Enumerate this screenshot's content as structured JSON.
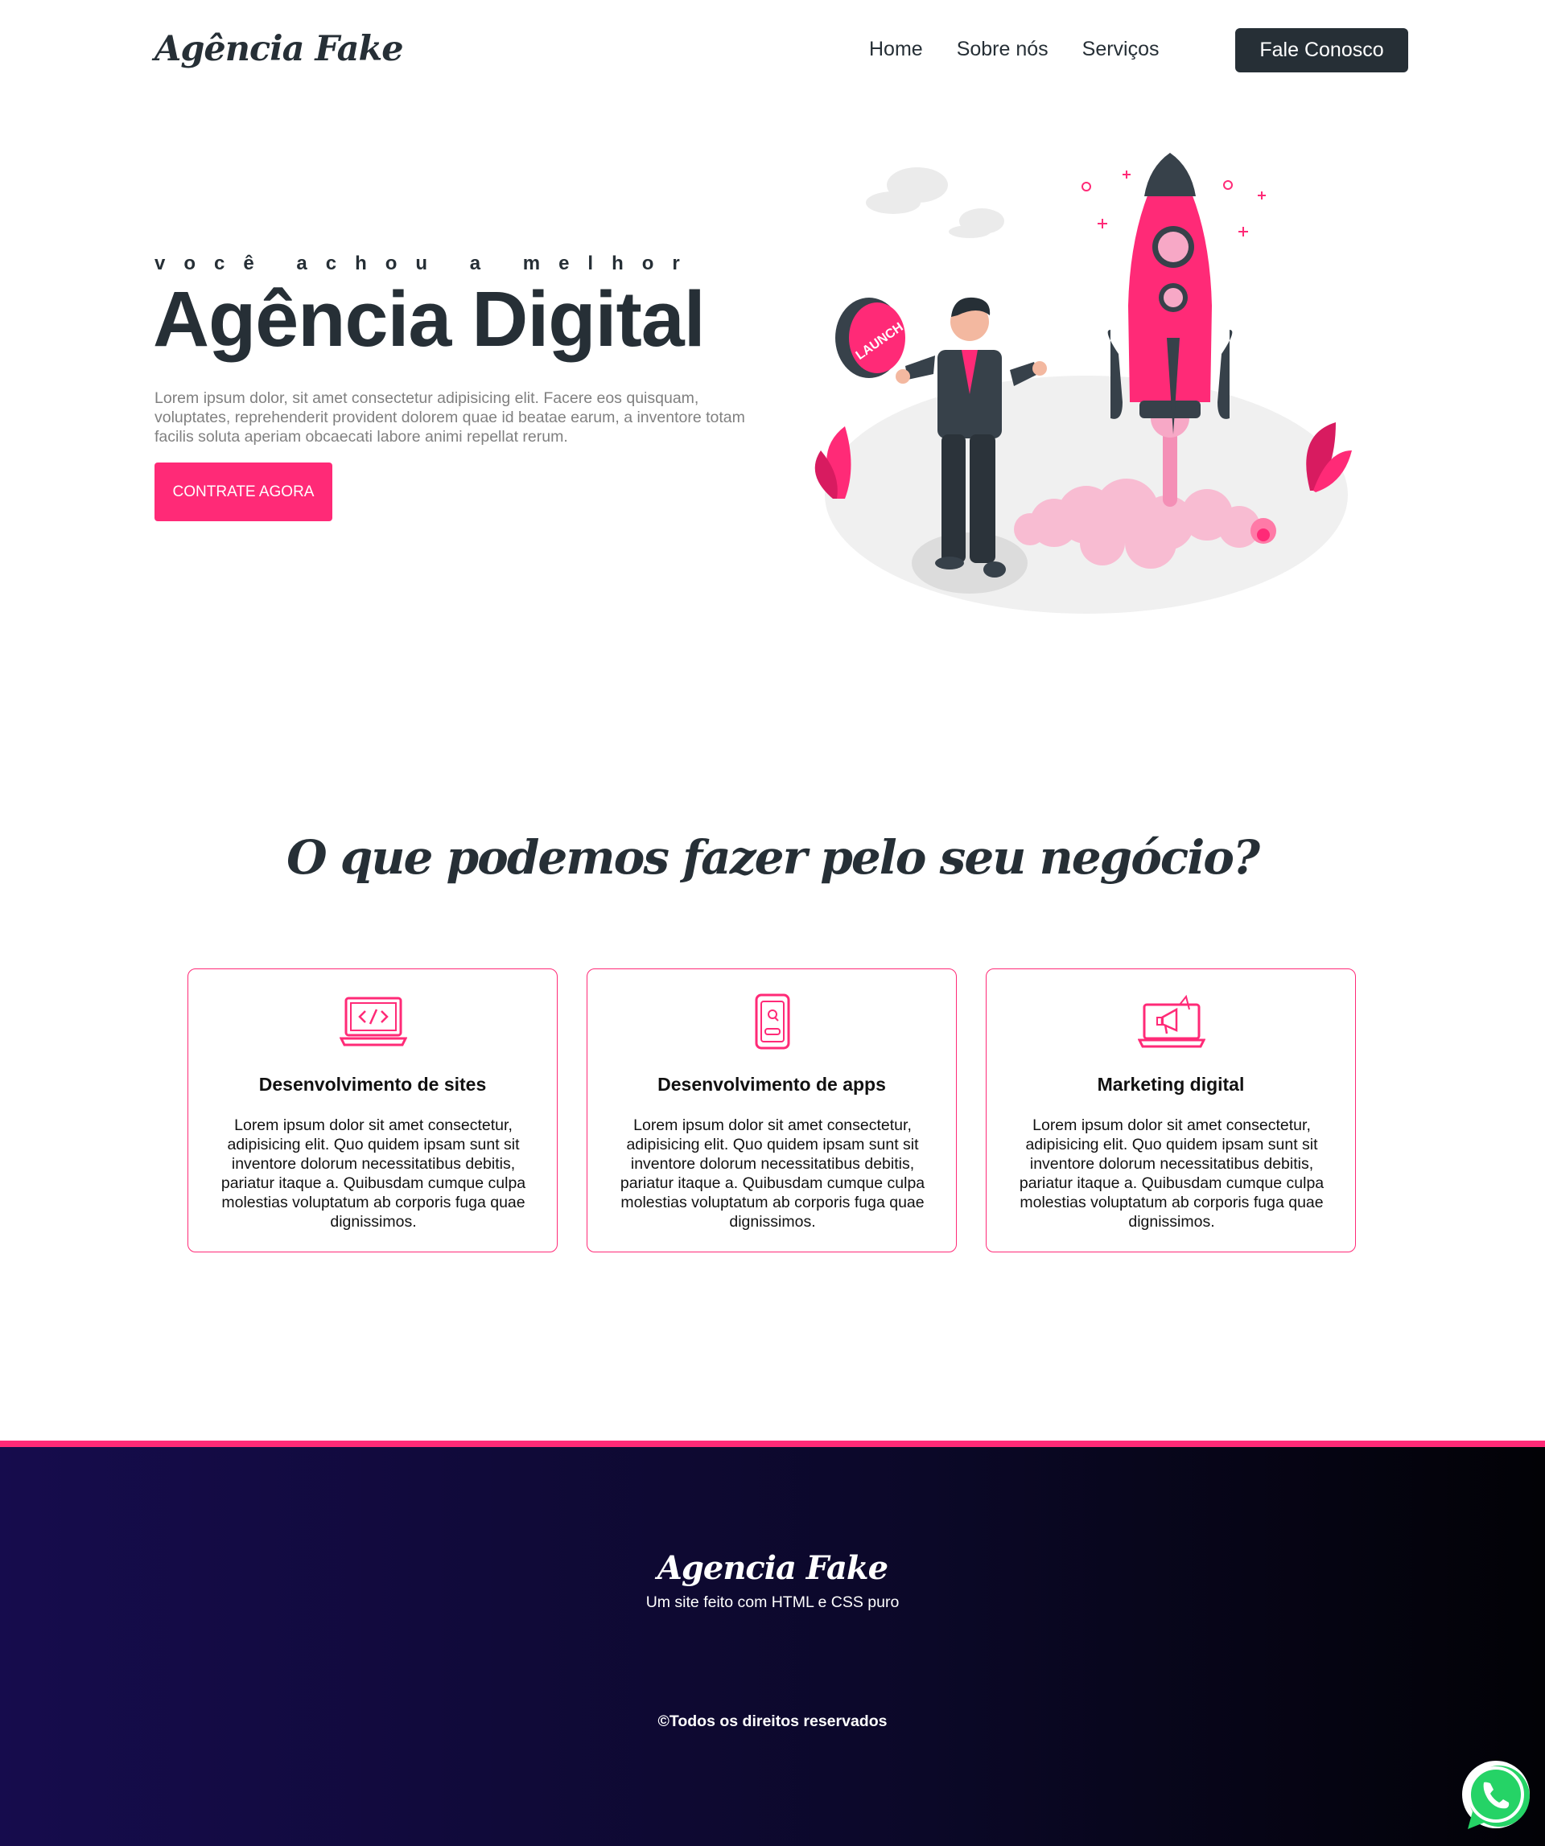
{
  "header": {
    "logo": "Agência Fake",
    "nav": [
      "Home",
      "Sobre nós",
      "Serviços"
    ],
    "cta": "Fale Conosco"
  },
  "hero": {
    "kicker": "você achou a melhor",
    "title": "Agência Digital",
    "text": "Lorem ipsum dolor, sit amet consectetur adipisicing elit. Facere eos quisquam, voluptates, reprehenderit provident dolorem quae id beatae earum, a inventore totam facilis soluta aperiam obcaecati labore animi repellat rerum.",
    "button": "CONTRATE AGORA",
    "illustration_button_text": "LAUNCH"
  },
  "services": {
    "title": "O que podemos fazer pelo seu negócio?",
    "cards": [
      {
        "title": "Desenvolvimento de sites",
        "icon": "laptop-code-icon",
        "text": "Lorem ipsum dolor sit amet consectetur, adipisicing elit. Quo quidem ipsam sunt sit inventore dolorum necessitatibus debitis, pariatur itaque a. Quibusdam cumque culpa molestias voluptatum ab corporis fuga quae dignissimos."
      },
      {
        "title": "Desenvolvimento de apps",
        "icon": "mobile-app-icon",
        "text": "Lorem ipsum dolor sit amet consectetur, adipisicing elit. Quo quidem ipsam sunt sit inventore dolorum necessitatibus debitis, pariatur itaque a. Quibusdam cumque culpa molestias voluptatum ab corporis fuga quae dignissimos."
      },
      {
        "title": "Marketing digital",
        "icon": "megaphone-laptop-icon",
        "text": "Lorem ipsum dolor sit amet consectetur, adipisicing elit. Quo quidem ipsam sunt sit inventore dolorum necessitatibus debitis, pariatur itaque a. Quibusdam cumque culpa molestias voluptatum ab corporis fuga quae dignissimos."
      }
    ]
  },
  "footer": {
    "logo": "Agencia Fake",
    "subtitle": "Um site feito com HTML e CSS puro",
    "copyright": "©Todos os direitos reservados"
  },
  "colors": {
    "accent": "#ff2a77",
    "dark": "#262f36"
  }
}
